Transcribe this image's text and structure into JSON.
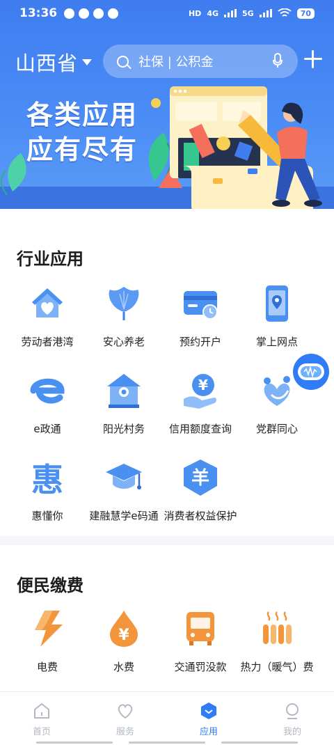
{
  "status_bar": {
    "time": "13:36",
    "network_1": "HD",
    "network_2": "4G",
    "network_3": "5G",
    "battery": "70"
  },
  "header": {
    "province": "山西省",
    "search_placeholder": "社保 | 公积金"
  },
  "banner": {
    "line1": "各类应用",
    "line2": "应有尽有"
  },
  "industry": {
    "title": "行业应用",
    "items": [
      {
        "label": "劳动者港湾",
        "icon": "house-heart-icon"
      },
      {
        "label": "安心养老",
        "icon": "ginkgo-leaf-icon"
      },
      {
        "label": "预约开户",
        "icon": "card-clock-icon"
      },
      {
        "label": "掌上网点",
        "icon": "phone-location-icon"
      },
      {
        "label": "e政通",
        "icon": "e-letter-icon"
      },
      {
        "label": "阳光村务",
        "icon": "sun-house-icon"
      },
      {
        "label": "信用额度查询",
        "icon": "yen-hand-icon"
      },
      {
        "label": "党群同心",
        "icon": "people-heart-icon"
      },
      {
        "label": "惠懂你",
        "icon": "hui-character-icon"
      },
      {
        "label": "建融慧学e码通",
        "icon": "graduation-cap-icon"
      },
      {
        "label": "消费者权益保护",
        "icon": "shield-yang-icon"
      }
    ]
  },
  "payment": {
    "title": "便民缴费",
    "items": [
      {
        "label": "电费",
        "icon": "lightning-icon"
      },
      {
        "label": "水费",
        "icon": "water-drop-yen-icon"
      },
      {
        "label": "交通罚没款",
        "icon": "bus-icon"
      },
      {
        "label": "热力（暖气）费",
        "icon": "radiator-icon"
      }
    ]
  },
  "bottom_nav": {
    "items": [
      {
        "label": "首页",
        "icon": "home-icon",
        "active": false
      },
      {
        "label": "服务",
        "icon": "heart-icon",
        "active": false
      },
      {
        "label": "应用",
        "icon": "apps-icon",
        "active": true
      },
      {
        "label": "我的",
        "icon": "profile-icon",
        "active": false
      }
    ]
  },
  "colors": {
    "brand_blue": "#3f7df0",
    "icon_blue": "#4a90f0",
    "icon_orange": "#f3953a",
    "nav_active": "#2f7cf6",
    "nav_inactive": "#b3b8c2"
  }
}
